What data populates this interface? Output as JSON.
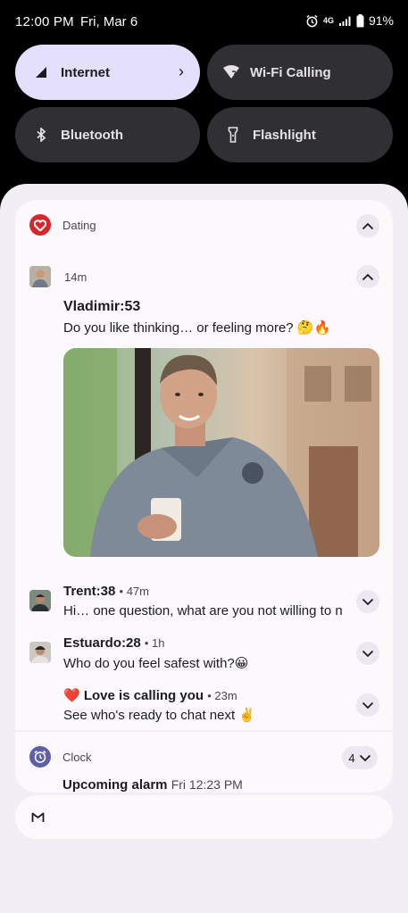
{
  "status_bar": {
    "time": "12:00 PM",
    "date": "Fri, Mar 6",
    "network": "4G",
    "battery": "91%"
  },
  "quick_settings": [
    {
      "label": "Internet",
      "icon": "signal-icon",
      "active": true
    },
    {
      "label": "Wi-Fi Calling",
      "icon": "wifi-calling-icon",
      "active": false
    },
    {
      "label": "Bluetooth",
      "icon": "bluetooth-icon",
      "active": false
    },
    {
      "label": "Flashlight",
      "icon": "flashlight-icon",
      "active": false
    }
  ],
  "dating": {
    "app_name": "Dating",
    "accent": "#d7262c",
    "main": {
      "time": "14m",
      "sender": "Vladimir:53",
      "message": "Do you like thinking… or feeling more? 🤔🔥"
    },
    "items": [
      {
        "sender": "Trent:38",
        "time": "• 47m",
        "message": "Hi… one question, what are you not willing to n.."
      },
      {
        "sender": "Estuardo:28",
        "time": "• 1h",
        "message": "Who do you feel safest with?😀"
      },
      {
        "sender": "❤️ Love is calling you",
        "time": "• 23m",
        "message": "See who's ready to chat next ✌️"
      }
    ]
  },
  "clock": {
    "app_name": "Clock",
    "count": "4",
    "title": "Upcoming alarm",
    "detail": "Fri 12:23 PM",
    "accent": "#5f5fa8"
  },
  "gmail": {
    "icon": "gmail-icon"
  }
}
